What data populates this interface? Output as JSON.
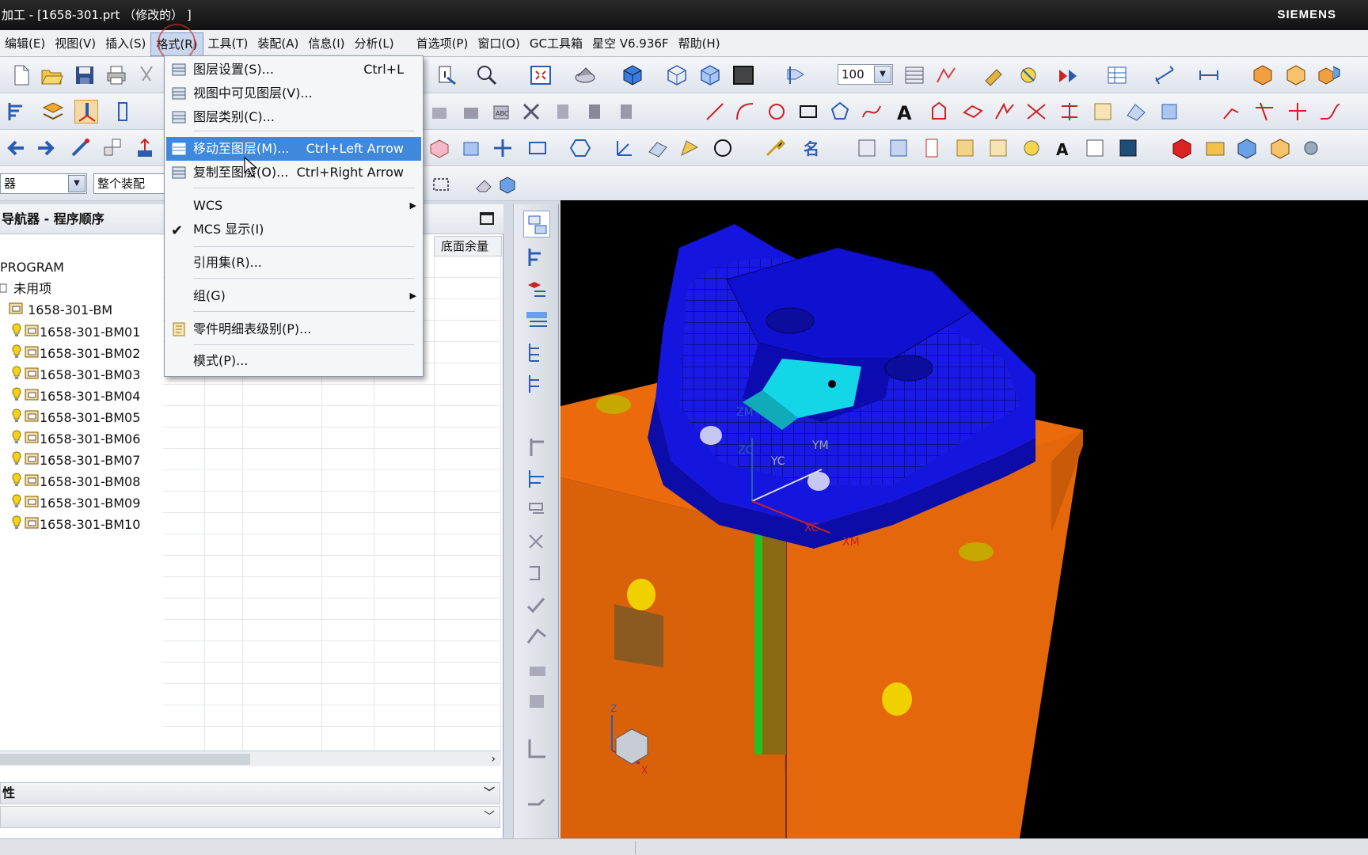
{
  "window": {
    "title": "加工 - [1658-301.prt （修改的） ]",
    "brand": "SIEMENS"
  },
  "menu": [
    "编辑(E)",
    "视图(V)",
    "插入(S)",
    "格式(R)",
    "工具(T)",
    "装配(A)",
    "信息(I)",
    "分析(L)",
    "首选项(P)",
    "窗口(O)",
    "GC工具箱",
    "星空 V6.936F",
    "帮助(H)"
  ],
  "toolbar": {
    "zoom_value": "100",
    "filter_left": "器",
    "filter_right": "整个装配"
  },
  "format_menu": {
    "items": [
      {
        "label": "图层设置(S)...",
        "shortcut": "Ctrl+L",
        "icon": "layer-settings-icon"
      },
      {
        "label": "视图中可见图层(V)...",
        "shortcut": "",
        "icon": "visible-layers-icon"
      },
      {
        "label": "图层类别(C)...",
        "shortcut": "",
        "icon": "layer-category-icon"
      },
      {
        "label": "移动至图层(M)...",
        "shortcut": "Ctrl+Left Arrow",
        "icon": "move-to-layer-icon",
        "highlighted": true
      },
      {
        "label": "复制至图层(O)...",
        "shortcut": "Ctrl+Right Arrow",
        "icon": "copy-to-layer-icon"
      },
      {
        "label": "WCS",
        "shortcut": "",
        "submenu": true
      },
      {
        "label": "MCS 显示(I)",
        "shortcut": "",
        "checked": true
      },
      {
        "label": "引用集(R)...",
        "shortcut": ""
      },
      {
        "label": "组(G)",
        "shortcut": "",
        "submenu": true
      },
      {
        "label": "零件明细表级别(P)...",
        "shortcut": "",
        "icon": "parts-list-icon"
      },
      {
        "label": "模式(P)...",
        "shortcut": ""
      }
    ]
  },
  "navigator": {
    "title": "导航器 - 程序顺序",
    "column_right": "底面余量",
    "rows": [
      "PROGRAM",
      "未用项",
      "1658-301-BM",
      "1658-301-BM01",
      "1658-301-BM02",
      "1658-301-BM03",
      "1658-301-BM04",
      "1658-301-BM05",
      "1658-301-BM06",
      "1658-301-BM07",
      "1658-301-BM08",
      "1658-301-BM09",
      "1658-301-BM10"
    ],
    "property_label": "性"
  },
  "viewport": {
    "axis_labels": {
      "zm": "ZM",
      "zc": "ZC",
      "ym": "YM",
      "yc": "YC",
      "xc": "XC",
      "xm": "XM"
    },
    "triad": {
      "z": "Z",
      "x": "X"
    },
    "colors": {
      "part_blue": "#1515e0",
      "base_orange": "#ea6a0c",
      "pocket_cyan": "#13d6e6",
      "hole_yellow": "#f1d000",
      "strip_green": "#22c020"
    }
  }
}
